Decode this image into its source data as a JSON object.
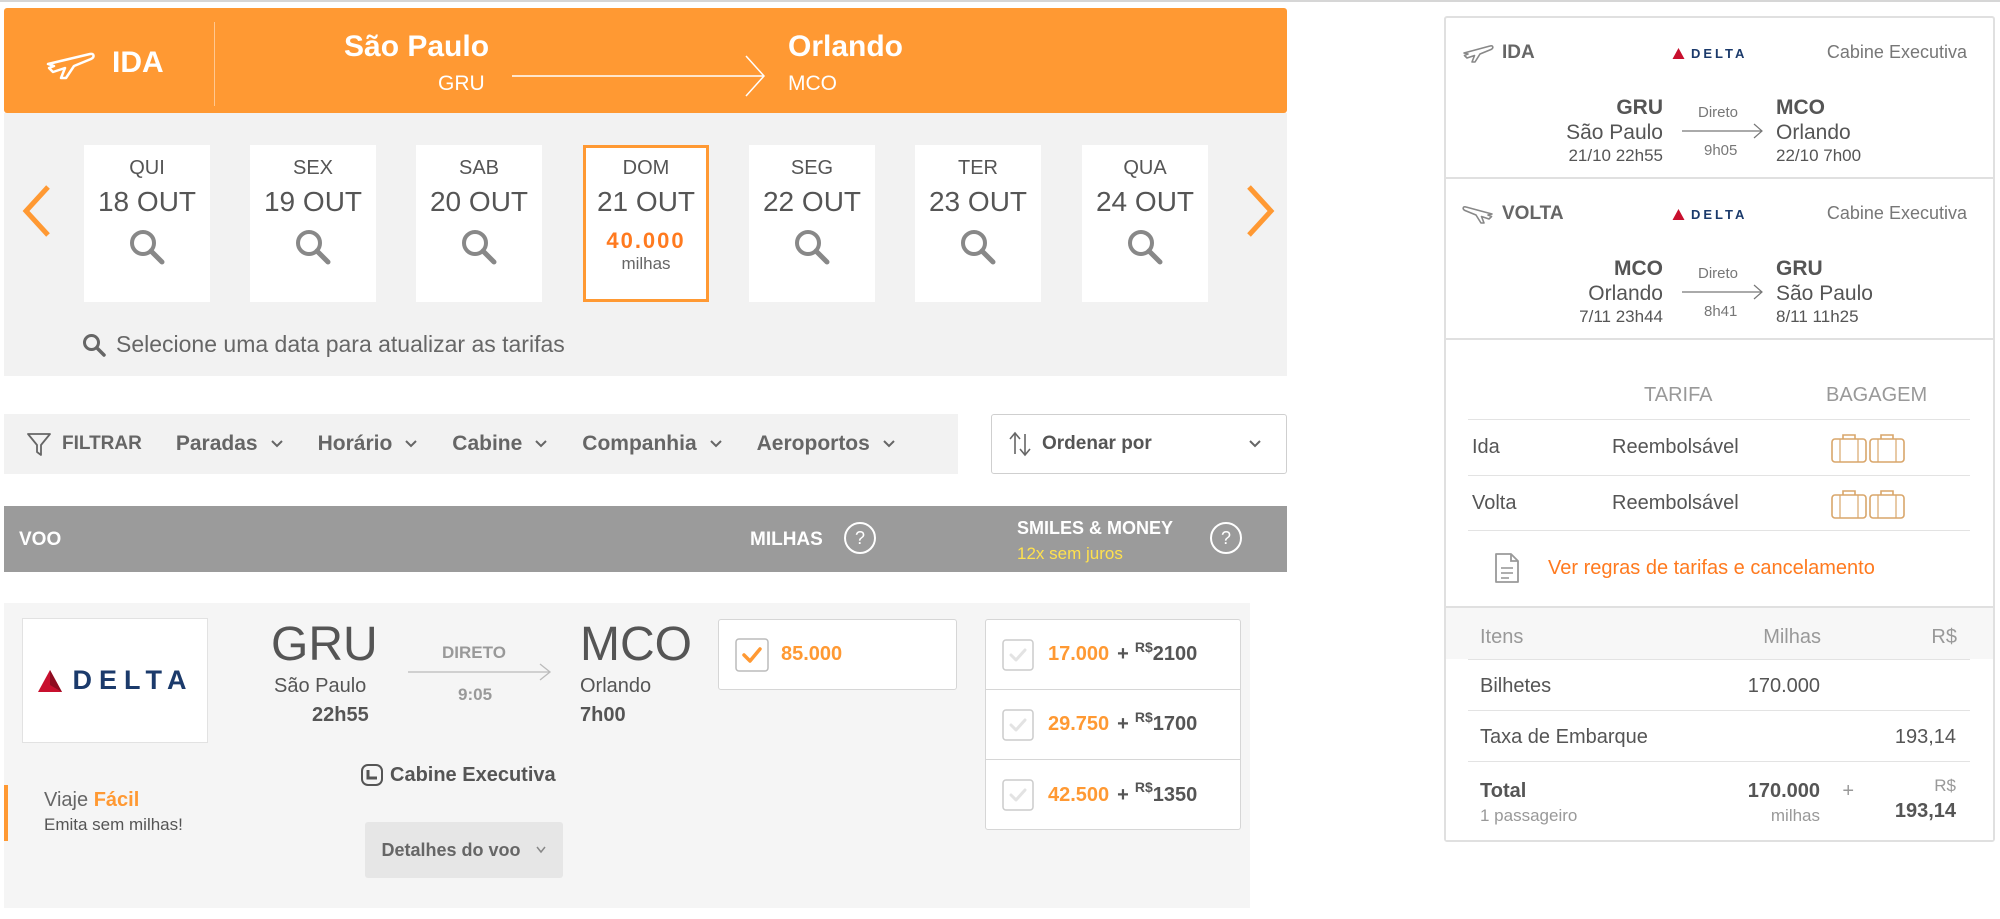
{
  "header": {
    "direction_label": "IDA",
    "origin_city": "São Paulo",
    "origin_code": "GRU",
    "dest_city": "Orlando",
    "dest_code": "MCO"
  },
  "dates": [
    {
      "dow": "QUI",
      "date": "18 OUT"
    },
    {
      "dow": "SEX",
      "date": "19 OUT"
    },
    {
      "dow": "SAB",
      "date": "20 OUT"
    },
    {
      "dow": "DOM",
      "date": "21 OUT",
      "price": "40.000",
      "unit": "milhas",
      "selected": true
    },
    {
      "dow": "SEG",
      "date": "22 OUT"
    },
    {
      "dow": "TER",
      "date": "23 OUT"
    },
    {
      "dow": "QUA",
      "date": "24 OUT"
    }
  ],
  "date_hint": "Selecione uma data para atualizar as tarifas",
  "filters": {
    "main_label": "FILTRAR",
    "options": [
      "Paradas",
      "Horário",
      "Cabine",
      "Companhia",
      "Aeroportos"
    ],
    "sort_label": "Ordenar por"
  },
  "table_header": {
    "voo": "VOO",
    "milhas": "MILHAS",
    "smiles_money": "SMILES & MONEY",
    "smiles_money_sub": "12x sem juros",
    "help": "?"
  },
  "flight": {
    "airline": "DELTA",
    "origin_code": "GRU",
    "origin_city": "São Paulo",
    "origin_time": "22h55",
    "direct_label": "DIRETO",
    "duration": "9:05",
    "dest_code": "MCO",
    "dest_city": "Orlando",
    "dest_time": "7h00",
    "cabin": "Cabine Executiva",
    "details_label": "Detalhes do voo",
    "promo_a": "Viaje",
    "promo_b": "Fácil",
    "promo_sub": "Emita sem milhas!",
    "milhas_value": "85.000",
    "smiles_options": [
      {
        "milhas": "17.000",
        "currency": "R$",
        "money": "2100"
      },
      {
        "milhas": "29.750",
        "currency": "R$",
        "money": "1700"
      },
      {
        "milhas": "42.500",
        "currency": "R$",
        "money": "1350"
      }
    ]
  },
  "summary": {
    "legs": [
      {
        "label": "IDA",
        "airline": "DELTA",
        "cabin": "Cabine Executiva",
        "origin_code": "GRU",
        "origin_city": "São Paulo",
        "origin_dt": "21/10 22h55",
        "direct": "Direto",
        "duration": "9h05",
        "dest_code": "MCO",
        "dest_city": "Orlando",
        "dest_dt": "22/10 7h00"
      },
      {
        "label": "VOLTA",
        "airline": "DELTA",
        "cabin": "Cabine Executiva",
        "origin_code": "MCO",
        "origin_city": "Orlando",
        "origin_dt": "7/11 23h44",
        "direct": "Direto",
        "duration": "8h41",
        "dest_code": "GRU",
        "dest_city": "São Paulo",
        "dest_dt": "8/11 11h25"
      }
    ],
    "fare": {
      "h_tarifa": "TARIFA",
      "h_bagagem": "BAGAGEM",
      "rows": [
        {
          "leg": "Ida",
          "tarifa": "Reembolsável"
        },
        {
          "leg": "Volta",
          "tarifa": "Reembolsável"
        }
      ],
      "rules_link": "Ver regras de tarifas e cancelamento"
    },
    "totals": {
      "h_itens": "Itens",
      "h_milhas": "Milhas",
      "h_rs": "R$",
      "bilhetes_label": "Bilhetes",
      "bilhetes_milhas": "170.000",
      "taxa_label": "Taxa de Embarque",
      "taxa_rs": "193,14",
      "total_label": "Total",
      "passengers": "1 passageiro",
      "total_milhas": "170.000",
      "milhas_unit": "milhas",
      "plus": "+",
      "total_currency": "R$",
      "total_rs": "193,14"
    }
  },
  "colors": {
    "accent": "#ff9933",
    "accent_text": "#ff7a1f",
    "header_gray": "#9b9b9b",
    "delta_blue": "#1b3a6b",
    "delta_red": "#c8102e"
  }
}
